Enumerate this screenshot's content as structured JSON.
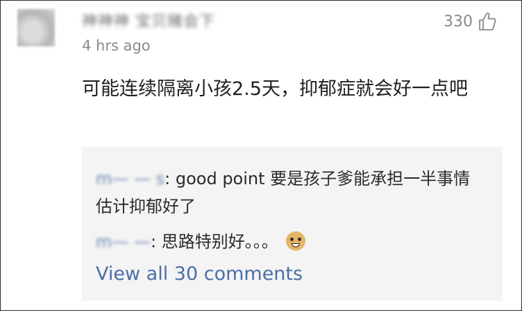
{
  "comment": {
    "username": "神神神 宝贝赌会下",
    "timestamp": "4 hrs ago",
    "like_count": "330",
    "body": "可能连续隔离小孩2.5天，抑郁症就会好一点吧"
  },
  "replies": [
    {
      "username": "m— — s",
      "separator": ": ",
      "text": "good point 要是孩子爹能承担一半事情 估计抑郁好了"
    },
    {
      "username": "m— —",
      "separator": ": ",
      "text": "思路特别好。。。",
      "emoji": "doge-emoji"
    }
  ],
  "view_all_label": "View all 30 comments",
  "icons": {
    "like": "thumbs-up-outline-icon"
  }
}
